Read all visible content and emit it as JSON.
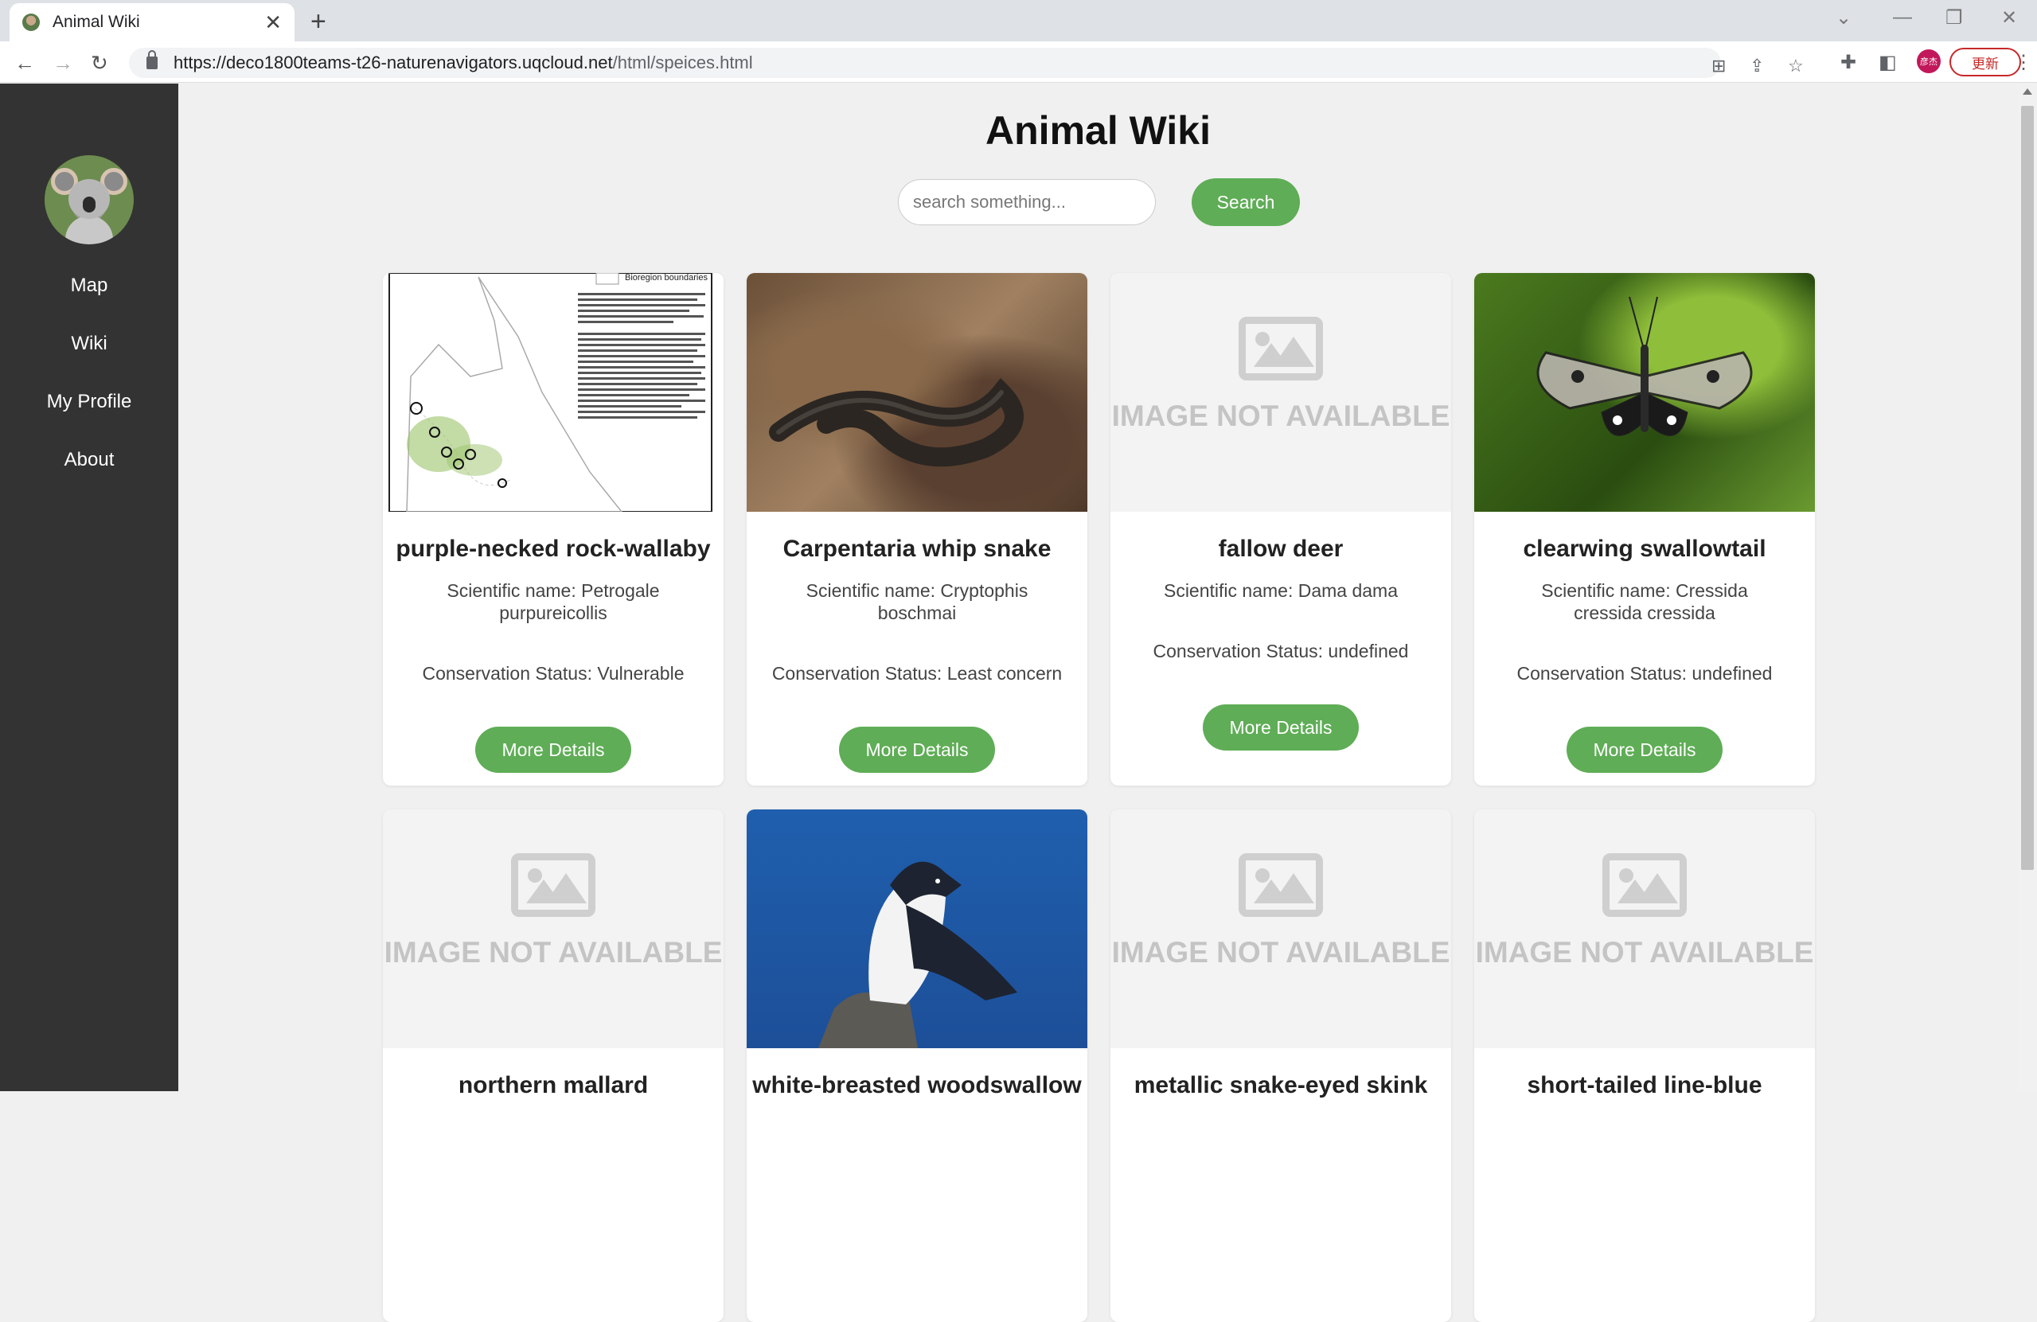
{
  "browser": {
    "tab_title": "Animal Wiki",
    "url_host": "https://deco1800teams-t26-naturenavigators.uqcloud.net",
    "url_path": "/html/speices.html",
    "profile_label": "彦杰",
    "update_label": "更新"
  },
  "sidebar": {
    "items": [
      {
        "label": "Map"
      },
      {
        "label": "Wiki"
      },
      {
        "label": "My Profile"
      },
      {
        "label": "About"
      }
    ]
  },
  "page": {
    "title": "Animal Wiki",
    "search_placeholder": "search something...",
    "search_label": "Search",
    "more_label": "More Details",
    "image_na": "IMAGE NOT AVAILABLE"
  },
  "cards": [
    {
      "name": "purple-necked rock-wallaby",
      "scientific": "Scientific name: Petrogale purpureicollis",
      "status": "Conservation Status: Vulnerable",
      "image": "map"
    },
    {
      "name": "Carpentaria whip snake",
      "scientific": "Scientific name: Cryptophis boschmai",
      "status": "Conservation Status: Least concern",
      "image": "snake"
    },
    {
      "name": "fallow deer",
      "scientific": "Scientific name: Dama dama",
      "status": "Conservation Status: undefined",
      "image": "not-available"
    },
    {
      "name": "clearwing swallowtail",
      "scientific": "Scientific name: Cressida cressida cressida",
      "status": "Conservation Status: undefined",
      "image": "butterfly"
    },
    {
      "name": "northern mallard",
      "image": "not-available"
    },
    {
      "name": "white-breasted woodswallow",
      "image": "bird"
    },
    {
      "name": "metallic snake-eyed skink",
      "image": "not-available"
    },
    {
      "name": "short-tailed line-blue",
      "image": "not-available"
    }
  ],
  "map_legend": "Bioregion boundaries",
  "colors": {
    "accent": "#5fad56",
    "sidebar": "#333333"
  }
}
